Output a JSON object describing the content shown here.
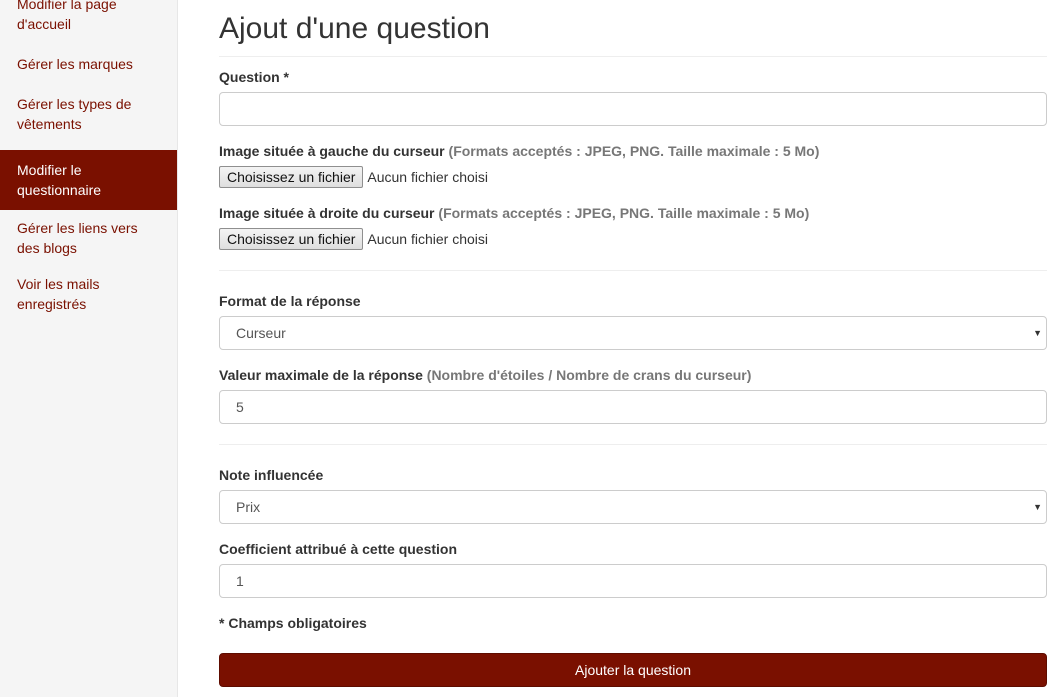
{
  "sidebar": {
    "items": [
      {
        "line1": "Modifier la page",
        "line2": "d'accueil"
      },
      {
        "line1": "Gérer les marques",
        "line2": ""
      },
      {
        "line1": "Gérer les types de",
        "line2": "vêtements"
      },
      {
        "line1": "Modifier le",
        "line2": "questionnaire"
      },
      {
        "line1": "Gérer les liens vers",
        "line2": "des blogs"
      },
      {
        "line1": "Voir les mails",
        "line2": "enregistrés"
      }
    ],
    "active_index": 3
  },
  "page": {
    "title": "Ajout d'une question"
  },
  "form": {
    "question": {
      "label": "Question *",
      "value": ""
    },
    "image_left": {
      "label": "Image située à gauche du curseur",
      "hint": "(Formats acceptés : JPEG, PNG. Taille maximale : 5 Mo)",
      "button": "Choisissez un fichier",
      "status": "Aucun fichier choisi"
    },
    "image_right": {
      "label": "Image située à droite du curseur",
      "hint": "(Formats acceptés : JPEG, PNG. Taille maximale : 5 Mo)",
      "button": "Choisissez un fichier",
      "status": "Aucun fichier choisi"
    },
    "format": {
      "label": "Format de la réponse",
      "value": "Curseur"
    },
    "max_value": {
      "label": "Valeur maximale de la réponse",
      "hint": "(Nombre d'étoiles / Nombre de crans du curseur)",
      "value": "5"
    },
    "note": {
      "label": "Note influencée",
      "value": "Prix"
    },
    "coefficient": {
      "label": "Coefficient attribué à cette question",
      "value": "1"
    },
    "required_note": "* Champs obligatoires",
    "submit": "Ajouter la question"
  },
  "colors": {
    "accent": "#7a1000",
    "sidebar_bg": "#f5f5f5",
    "hint": "#777777"
  },
  "icons": {
    "select_caret": "caret-down-icon"
  }
}
